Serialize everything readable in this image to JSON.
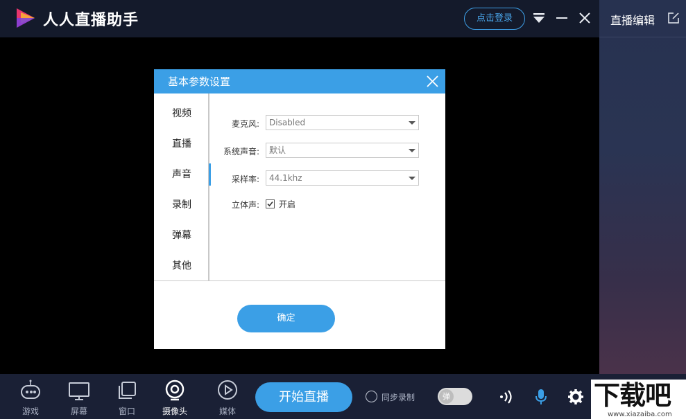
{
  "app": {
    "title": "人人直播助手"
  },
  "header": {
    "login_label": "点击登录"
  },
  "right_panel": {
    "title": "直播编辑"
  },
  "dialog": {
    "title": "基本参数设置",
    "nav": [
      "视频",
      "直播",
      "声音",
      "录制",
      "弹幕",
      "其他"
    ],
    "active_nav": "声音",
    "fields": {
      "mic_label": "麦克风:",
      "mic_value": "Disabled",
      "system_label": "系统声音:",
      "system_value": "默认",
      "rate_label": "采样率:",
      "rate_value": "44.1khz",
      "stereo_label": "立体声:",
      "stereo_option": "开启",
      "stereo_checked": true
    },
    "confirm_label": "确定"
  },
  "bottombar": {
    "tools": [
      "游戏",
      "屏幕",
      "窗口",
      "摄像头",
      "媒体"
    ],
    "start_label": "开始直播",
    "sync_label": "同步录制",
    "toggle_label": "弹"
  },
  "watermark": {
    "text": "下载吧",
    "url": "www.xiazaiba.com"
  },
  "colors": {
    "accent": "#3b9fe6",
    "titlebar": "#141a2b",
    "bottombar": "#1a2035"
  }
}
